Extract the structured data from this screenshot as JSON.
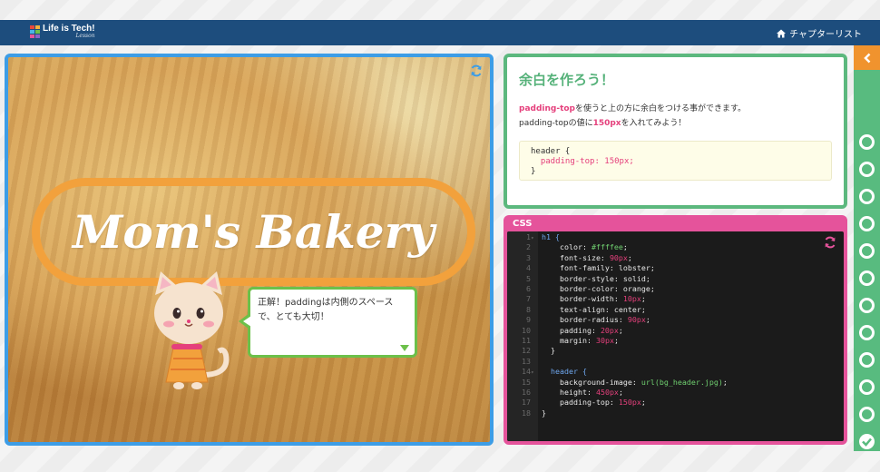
{
  "header": {
    "logo_text": "Life is Tech!",
    "logo_sub": "Lesson",
    "chapter_list_label": "チャプターリスト"
  },
  "preview": {
    "bakery_title": "Mom's Bakery",
    "bubble_text": "正解！paddingは内側のスペースで、とても大切！"
  },
  "instructions": {
    "title": "余白を作ろう！",
    "line1_highlight": "padding-top",
    "line1_rest": "を使うと上の方に余白をつける事ができます。",
    "line2_prefix": "padding-topの値に",
    "line2_highlight": "150px",
    "line2_suffix": "を入れてみよう！",
    "hint_line1": "header {",
    "hint_line2": "  padding-top: 150px;",
    "hint_line3": "}"
  },
  "editor": {
    "label": "CSS",
    "lines": [
      {
        "n": "1",
        "fold": "▾",
        "parts": [
          [
            "sel",
            "h1 {"
          ]
        ]
      },
      {
        "n": "2",
        "fold": "",
        "parts": [
          [
            "prop",
            "    color: "
          ],
          [
            "val",
            "#ffffee"
          ],
          [
            "prop",
            ";"
          ]
        ]
      },
      {
        "n": "3",
        "fold": "",
        "parts": [
          [
            "prop",
            "    font-size: "
          ],
          [
            "num",
            "90px"
          ],
          [
            "prop",
            ";"
          ]
        ]
      },
      {
        "n": "4",
        "fold": "",
        "parts": [
          [
            "prop",
            "    font-family: lobster;"
          ]
        ]
      },
      {
        "n": "5",
        "fold": "",
        "parts": [
          [
            "prop",
            "    border-style: solid;"
          ]
        ]
      },
      {
        "n": "6",
        "fold": "",
        "parts": [
          [
            "prop",
            "    border-color: orange;"
          ]
        ]
      },
      {
        "n": "7",
        "fold": "",
        "parts": [
          [
            "prop",
            "    border-width: "
          ],
          [
            "num",
            "10px"
          ],
          [
            "prop",
            ";"
          ]
        ]
      },
      {
        "n": "8",
        "fold": "",
        "parts": [
          [
            "prop",
            "    text-align: center;"
          ]
        ]
      },
      {
        "n": "9",
        "fold": "",
        "parts": [
          [
            "prop",
            "    border-radius: "
          ],
          [
            "num",
            "90px"
          ],
          [
            "prop",
            ";"
          ]
        ]
      },
      {
        "n": "10",
        "fold": "",
        "parts": [
          [
            "prop",
            "    padding: "
          ],
          [
            "num",
            "20px"
          ],
          [
            "prop",
            ";"
          ]
        ]
      },
      {
        "n": "11",
        "fold": "",
        "parts": [
          [
            "prop",
            "    margin: "
          ],
          [
            "num",
            "30px"
          ],
          [
            "prop",
            ";"
          ]
        ]
      },
      {
        "n": "12",
        "fold": "",
        "parts": [
          [
            "prop",
            "  }"
          ]
        ]
      },
      {
        "n": "13",
        "fold": "",
        "parts": []
      },
      {
        "n": "14",
        "fold": "▾",
        "parts": [
          [
            "sel",
            "  header {"
          ]
        ]
      },
      {
        "n": "15",
        "fold": "",
        "parts": [
          [
            "prop",
            "    background-image: "
          ],
          [
            "val",
            "url(bg_header.jpg)"
          ],
          [
            "prop",
            ";"
          ]
        ]
      },
      {
        "n": "16",
        "fold": "",
        "parts": [
          [
            "prop",
            "    height: "
          ],
          [
            "num",
            "450px"
          ],
          [
            "prop",
            ";"
          ]
        ]
      },
      {
        "n": "17",
        "fold": "",
        "parts": [
          [
            "prop",
            "    padding-top: "
          ],
          [
            "num",
            "150px"
          ],
          [
            "prop",
            ";"
          ]
        ]
      },
      {
        "n": "18",
        "fold": "",
        "parts": [
          [
            "prop",
            "}"
          ]
        ]
      }
    ]
  },
  "progress": {
    "steps_total": 11,
    "steps_completed_marker": "final-check",
    "colors": {
      "accent_green": "#58bb7f",
      "collapse_orange": "#f0932e",
      "editor_pink": "#e5539b",
      "preview_blue": "#3d9de6"
    }
  }
}
